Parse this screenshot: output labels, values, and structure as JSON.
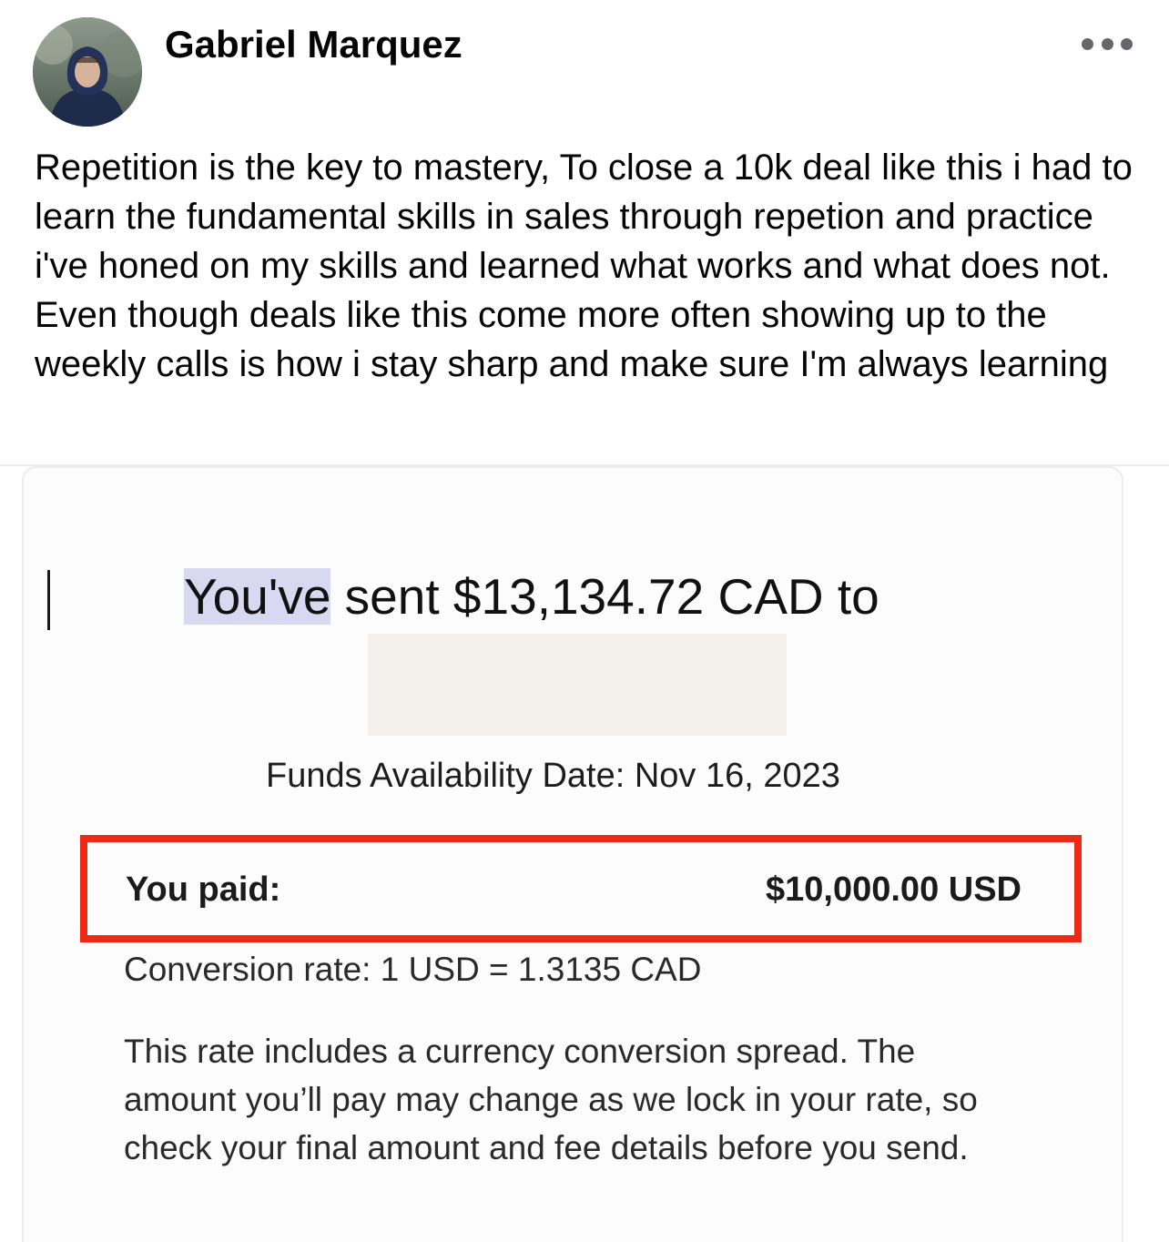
{
  "post": {
    "author": "Gabriel Marquez",
    "text": "Repetition is the key to mastery, To close a 10k deal like this i had to learn the fundamental skills in sales through repetion and practice i've honed on my skills and learned what works and what does not. Even though deals like this come more often showing up to the weekly calls is how i stay sharp and make sure I'm always learning"
  },
  "receipt": {
    "heading_highlight": "You've",
    "heading_rest": " sent $13,134.72 CAD to",
    "funds_availability": "Funds Availability Date: Nov 16, 2023",
    "paid_label": "You paid:",
    "paid_value": "$10,000.00 USD",
    "conversion_rate": "Conversion rate: 1 USD = 1.3135 CAD",
    "disclaimer": "This rate includes a currency conversion spread. The amount you’ll pay may change as we lock in your rate, so check your final amount and fee details before you send."
  },
  "colors": {
    "highlight_box": "#ee2a17",
    "text_selection": "#d8d8f0"
  },
  "icons": {
    "more_options": "more-horizontal-icon"
  }
}
